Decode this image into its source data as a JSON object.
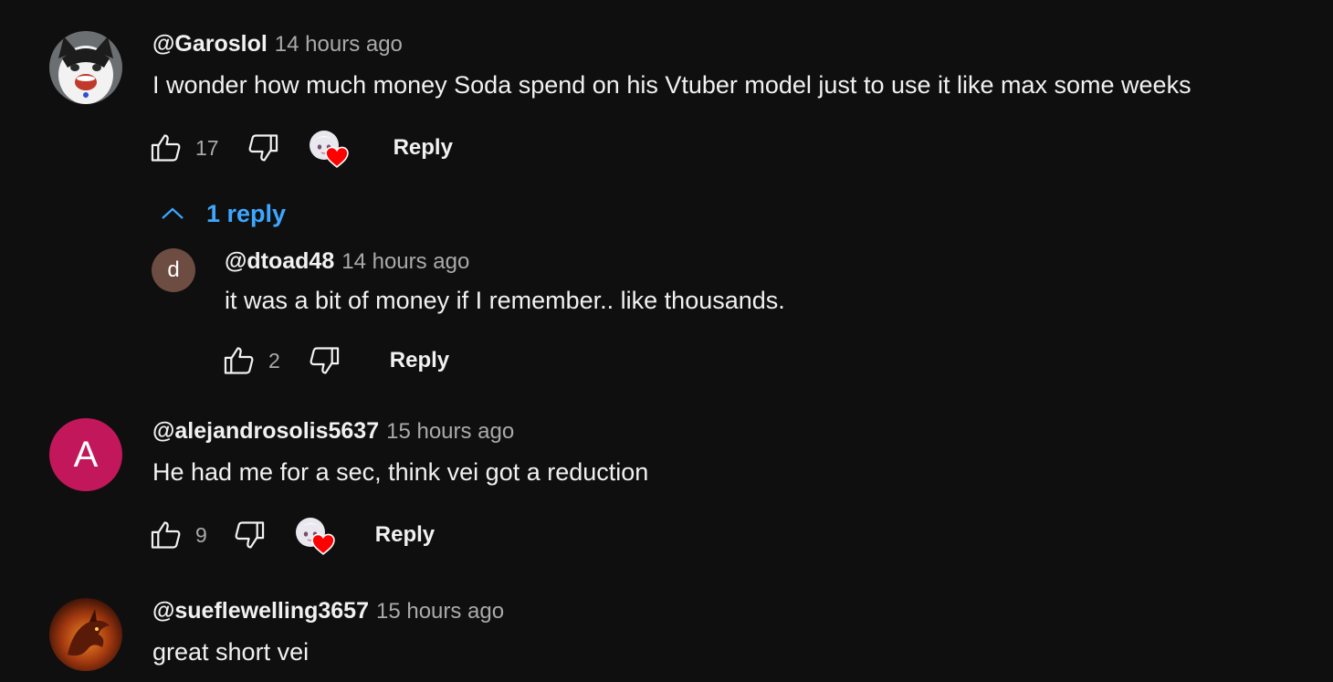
{
  "comments": [
    {
      "author": "@Garoslol",
      "time": "14 hours ago",
      "text": "I wonder how much money Soda spend on his Vtuber model just to use it like max some weeks",
      "likes": "17",
      "reply_label": "Reply",
      "avatar_icon": "cat-avatar",
      "creator_hearted": true,
      "replies_toggle": "1 reply"
    },
    {
      "author": "@dtoad48",
      "time": "14 hours ago",
      "text": "it was a bit of money if I remember.. like thousands.",
      "likes": "2",
      "reply_label": "Reply",
      "avatar_letter": "d",
      "avatar_color": "#6d4c41",
      "creator_hearted": false
    },
    {
      "author": "@alejandrosolis5637",
      "time": "15 hours ago",
      "text": "He had me for a sec, think vei got a reduction",
      "likes": "9",
      "reply_label": "Reply",
      "avatar_letter": "A",
      "avatar_color": "#c2185b",
      "creator_hearted": true
    },
    {
      "author": "@sueflewelling3657",
      "time": "15 hours ago",
      "text": "great short vei",
      "avatar_icon": "dragon-avatar"
    }
  ],
  "colors": {
    "background": "#0f0f0f",
    "link_blue": "#3ea6ff",
    "heart_red": "#ff0000",
    "secondary_text": "#aaaaaa"
  }
}
